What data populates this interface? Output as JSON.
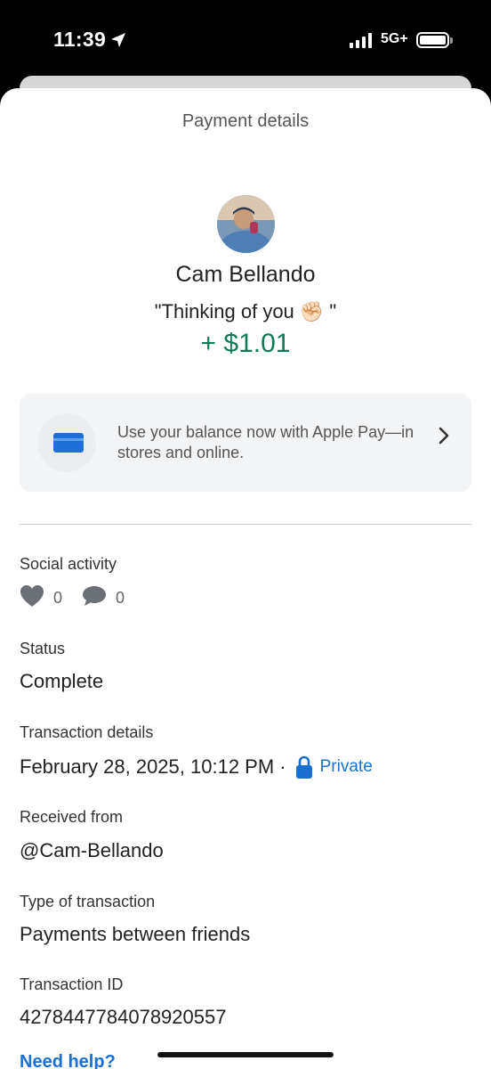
{
  "status_bar": {
    "time": "11:39",
    "network": "5G+"
  },
  "sheet": {
    "title": "Payment details"
  },
  "payment": {
    "sender_name": "Cam Bellando",
    "note": "\"Thinking of you ✊🏻 \"",
    "amount": "+ $1.01"
  },
  "promo": {
    "text": "Use your balance now with Apple Pay—in stores and online."
  },
  "social": {
    "label": "Social activity",
    "likes": "0",
    "comments": "0"
  },
  "status": {
    "label": "Status",
    "value": "Complete"
  },
  "transaction_details": {
    "label": "Transaction details",
    "datetime": "February 28, 2025, 10:12 PM ·",
    "privacy": "Private"
  },
  "received_from": {
    "label": "Received from",
    "value": "@Cam-Bellando"
  },
  "type": {
    "label": "Type of transaction",
    "value": "Payments between friends"
  },
  "transaction_id": {
    "label": "Transaction ID",
    "value": "4278447784078920557"
  },
  "help": {
    "label": "Need help?"
  },
  "colors": {
    "amount": "#127a5a",
    "link": "#1a6fd1",
    "card": "#1f6fd6"
  }
}
